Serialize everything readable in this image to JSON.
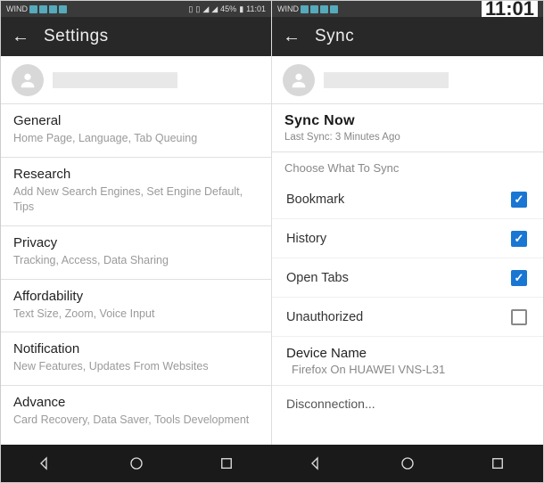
{
  "statusbar": {
    "carrier": "WIND",
    "battery": "45%",
    "time": "11:01",
    "carrier2": "WIND",
    "big_time": "11:01"
  },
  "left": {
    "header": "Settings",
    "sections": [
      {
        "title": "General",
        "sub": "Home Page, Language, Tab Queuing"
      },
      {
        "title": "Research",
        "sub": "Add New Search Engines, Set Engine Default, Tips"
      },
      {
        "title": "Privacy",
        "sub": "Tracking, Access, Data Sharing"
      },
      {
        "title": "Affordability",
        "sub": "Text Size, Zoom, Voice Input"
      },
      {
        "title": "Notification",
        "sub": "New Features, Updates From Websites"
      },
      {
        "title": "Advance",
        "sub": "Card Recovery, Data Saver, Tools Development"
      }
    ]
  },
  "right": {
    "header": "Sync",
    "sync_now": "Sync Now",
    "last_sync": "Last Sync: 3 Minutes Ago",
    "choose_label": "Choose What To Sync",
    "items": [
      {
        "label": "Bookmark",
        "checked": true
      },
      {
        "label": "History",
        "checked": true
      },
      {
        "label": "Open Tabs",
        "checked": true
      },
      {
        "label": "Unauthorized",
        "checked": false
      }
    ],
    "device_label": "Device Name",
    "device_value": "Firefox On HUAWEI VNS-L31",
    "disconnect": "Disconnection..."
  }
}
